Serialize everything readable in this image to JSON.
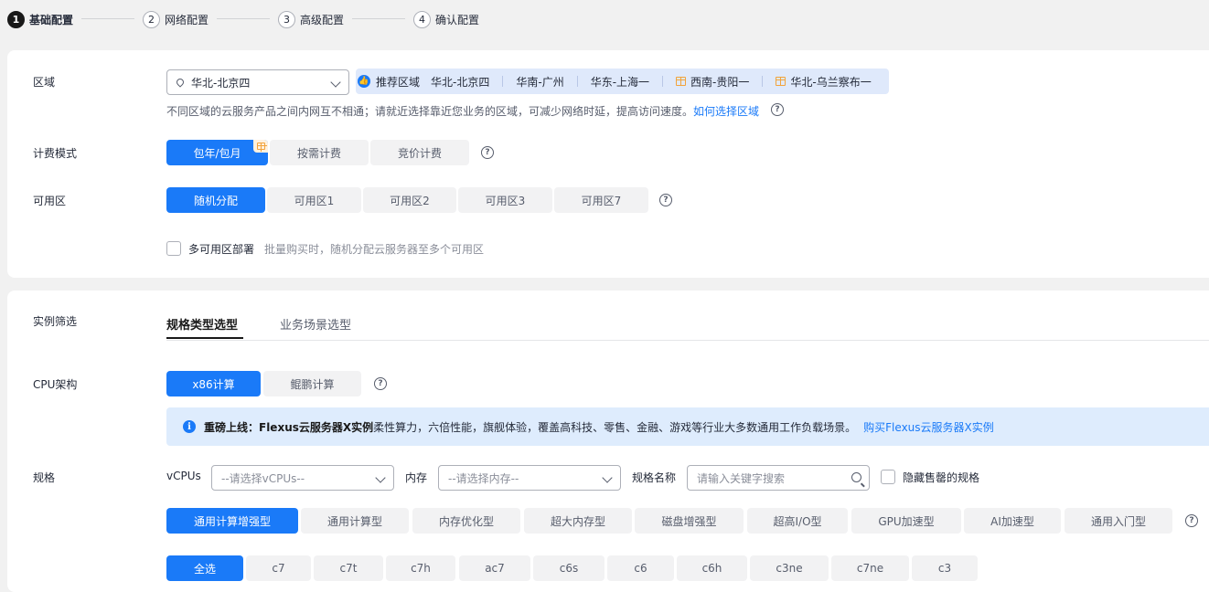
{
  "steps": [
    {
      "num": "1",
      "label": "基础配置"
    },
    {
      "num": "2",
      "label": "网络配置"
    },
    {
      "num": "3",
      "label": "高级配置"
    },
    {
      "num": "4",
      "label": "确认配置"
    }
  ],
  "region": {
    "label": "区域",
    "selected": "华北-北京四",
    "recommend_label": "推荐区域",
    "recommended": [
      "华北-北京四",
      "华南-广州",
      "华东-上海一",
      "西南-贵阳一",
      "华北-乌兰察布一"
    ],
    "hint": "不同区域的云服务产品之间内网互不相通；请就近选择靠近您业务的区域，可减少网络时延，提高访问速度。",
    "hint_link": "如何选择区域"
  },
  "billing": {
    "label": "计费模式",
    "options": [
      "包年/包月",
      "按需计费",
      "竞价计费"
    ]
  },
  "az": {
    "label": "可用区",
    "options": [
      "随机分配",
      "可用区1",
      "可用区2",
      "可用区3",
      "可用区7"
    ],
    "multi_label": "多可用区部署",
    "multi_hint": "批量购买时，随机分配云服务器至多个可用区"
  },
  "filter": {
    "label": "实例筛选",
    "tabs": [
      "规格类型选型",
      "业务场景选型"
    ]
  },
  "cpu": {
    "label": "CPU架构",
    "options": [
      "x86计算",
      "鲲鹏计算"
    ]
  },
  "banner": {
    "title": "重磅上线：Flexus云服务器X实例",
    "text": " 柔性算力，六倍性能，旗舰体验，覆盖高科技、零售、金融、游戏等行业大多数通用工作负载场景。",
    "link": "购买Flexus云服务器X实例"
  },
  "spec": {
    "label": "规格",
    "vcpus_label": "vCPUs",
    "vcpus_placeholder": "--请选择vCPUs--",
    "mem_label": "内存",
    "mem_placeholder": "--请选择内存--",
    "name_label": "规格名称",
    "name_placeholder": "请输入关键字搜索",
    "hide_soldout": "隐藏售罄的规格",
    "types": [
      "通用计算增强型",
      "通用计算型",
      "内存优化型",
      "超大内存型",
      "磁盘增强型",
      "超高I/O型",
      "GPU加速型",
      "AI加速型",
      "通用入门型"
    ],
    "families": [
      "全选",
      "c7",
      "c7t",
      "c7h",
      "ac7",
      "c6s",
      "c6",
      "c6h",
      "c3ne",
      "c7ne",
      "c3"
    ]
  },
  "colors": {
    "accent": "#1a7af8",
    "banner_bg": "#deecfd",
    "recommend_bg": "#dfe9fb"
  }
}
